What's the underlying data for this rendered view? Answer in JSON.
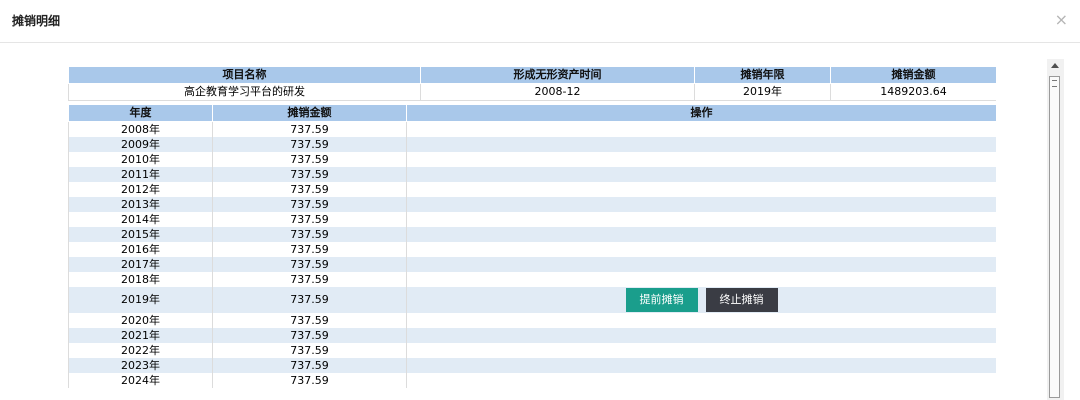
{
  "modal": {
    "title": "摊销明细",
    "close_label": "×"
  },
  "info_table": {
    "headers": [
      "项目名称",
      "形成无形资产时间",
      "摊销年限",
      "摊销金额"
    ],
    "row": [
      "高企教育学习平台的研发",
      "2008-12",
      "2019年",
      "1489203.64"
    ]
  },
  "year_table": {
    "headers": [
      "年度",
      "摊销金额",
      "操作"
    ],
    "rows": [
      {
        "year": "2008年",
        "amount": "737.59"
      },
      {
        "year": "2009年",
        "amount": "737.59"
      },
      {
        "year": "2010年",
        "amount": "737.59"
      },
      {
        "year": "2011年",
        "amount": "737.59"
      },
      {
        "year": "2012年",
        "amount": "737.59"
      },
      {
        "year": "2013年",
        "amount": "737.59"
      },
      {
        "year": "2014年",
        "amount": "737.59"
      },
      {
        "year": "2015年",
        "amount": "737.59"
      },
      {
        "year": "2016年",
        "amount": "737.59"
      },
      {
        "year": "2017年",
        "amount": "737.59"
      },
      {
        "year": "2018年",
        "amount": "737.59"
      },
      {
        "year": "2019年",
        "amount": "737.59",
        "actions": [
          "提前摊销",
          "终止摊销"
        ]
      },
      {
        "year": "2020年",
        "amount": "737.59"
      },
      {
        "year": "2021年",
        "amount": "737.59"
      },
      {
        "year": "2022年",
        "amount": "737.59"
      },
      {
        "year": "2023年",
        "amount": "737.59"
      },
      {
        "year": "2024年",
        "amount": "737.59"
      }
    ]
  },
  "colors": {
    "header_bg": "#a9c8ea",
    "stripe_bg": "#e1ebf5",
    "early_button": "#1a9e8c",
    "stop_button": "#3a3c44"
  }
}
